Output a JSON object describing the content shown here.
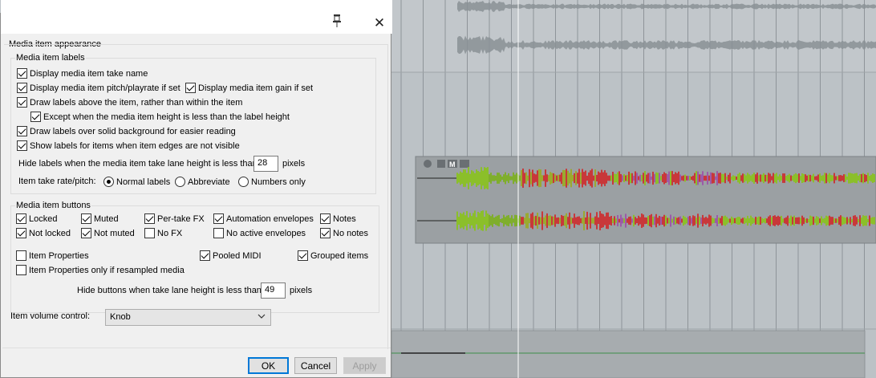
{
  "dialog": {
    "section_title": "Media item appearance",
    "labels_group": {
      "title": "Media item labels",
      "take_name": "Display media item take name",
      "pitch_playrate": "Display media item pitch/playrate if set",
      "gain": "Display media item gain if set",
      "above_item": "Draw labels above the item, rather than within the item",
      "except_height": "Except when the media item height is less than the label height",
      "solid_background": "Draw labels over solid background for easier reading",
      "edges_not_visible": "Show labels for items when item edges are not visible",
      "hide_labels_text": "Hide labels when the media item take lane height is less than:",
      "hide_labels_value": "28",
      "hide_labels_unit": "pixels",
      "rate_pitch_label": "Item take rate/pitch:",
      "radio_normal": "Normal labels",
      "radio_abbrev": "Abbreviate",
      "radio_numbers": "Numbers only"
    },
    "buttons_group": {
      "title": "Media item buttons",
      "locked": "Locked",
      "not_locked": "Not locked",
      "muted": "Muted",
      "not_muted": "Not muted",
      "per_take_fx": "Per-take FX",
      "no_fx": "No FX",
      "automation_env": "Automation envelopes",
      "no_active_env": "No active envelopes",
      "notes": "Notes",
      "no_notes": "No notes",
      "item_properties": "Item Properties",
      "item_properties_resampled": "Item Properties only if resampled media",
      "pooled_midi": "Pooled MIDI",
      "grouped_items": "Grouped items",
      "hide_buttons_text": "Hide buttons when take lane height is less than:",
      "hide_buttons_value": "49",
      "hide_buttons_unit": "pixels"
    },
    "volume_label": "Item volume control:",
    "volume_value": "Knob",
    "ok": "OK",
    "cancel": "Cancel",
    "apply": "Apply"
  },
  "arrange": {
    "item_buttons": [
      "M"
    ]
  }
}
